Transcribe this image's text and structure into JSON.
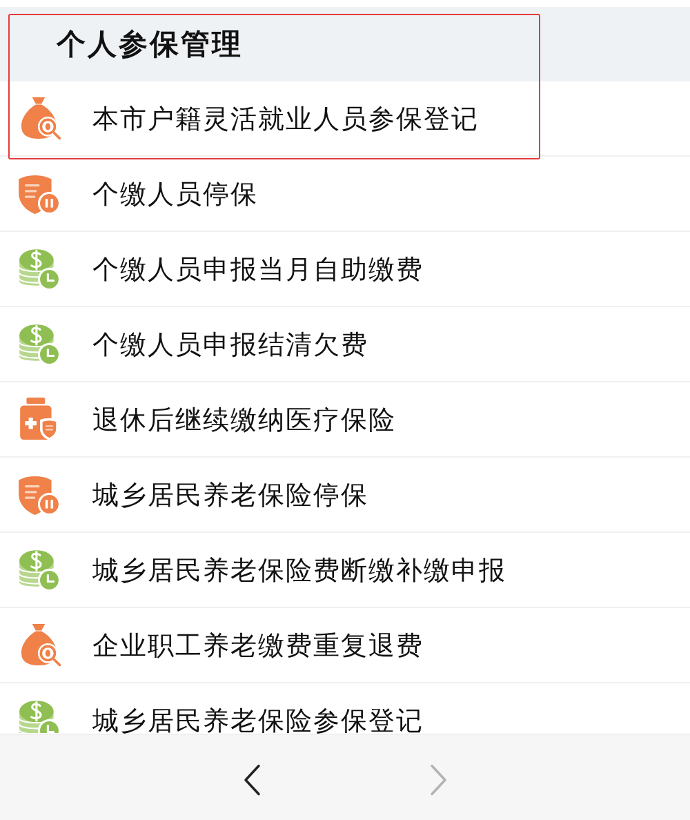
{
  "section": {
    "title": "个人参保管理",
    "highlighted": true
  },
  "items": [
    {
      "label": "本市户籍灵活就业人员参保登记",
      "kind": "bag",
      "highlighted": true
    },
    {
      "label": "个缴人员停保",
      "kind": "shield",
      "highlighted": false
    },
    {
      "label": "个缴人员申报当月自助缴费",
      "kind": "coins",
      "highlighted": false
    },
    {
      "label": "个缴人员申报结清欠费",
      "kind": "coins",
      "highlighted": false
    },
    {
      "label": "退休后继续缴纳医疗保险",
      "kind": "bottle",
      "highlighted": false
    },
    {
      "label": "城乡居民养老保险停保",
      "kind": "shield",
      "highlighted": false
    },
    {
      "label": "城乡居民养老保险费断缴补缴申报",
      "kind": "coins",
      "highlighted": false
    },
    {
      "label": "企业职工养老缴费重复退费",
      "kind": "bag",
      "highlighted": false
    },
    {
      "label": "城乡居民养老保险参保登记",
      "kind": "coins",
      "highlighted": false
    }
  ],
  "nav": [
    {
      "kind": "back",
      "disabled": false
    },
    {
      "kind": "forward",
      "disabled": true
    }
  ]
}
